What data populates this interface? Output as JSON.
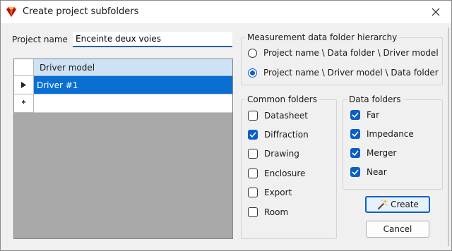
{
  "window": {
    "title": "Create project subfolders",
    "icon": "app-logo-icon",
    "close_icon": "close-icon"
  },
  "project": {
    "label": "Project name",
    "value": "Enceinte deux voies"
  },
  "grid": {
    "column_header": "Driver model",
    "rows": [
      {
        "value": "Driver #1",
        "selected": true,
        "indicator": "current-row-arrow-icon"
      },
      {
        "value": "",
        "selected": false,
        "indicator": "new-row-asterisk-icon"
      }
    ]
  },
  "hierarchy": {
    "title": "Measurement data folder hierarchy",
    "options": [
      {
        "label": "Project name \\ Data folder \\ Driver model",
        "selected": false
      },
      {
        "label": "Project name \\ Driver model \\ Data folder",
        "selected": true
      }
    ]
  },
  "common_folders": {
    "title": "Common folders",
    "items": [
      {
        "label": "Datasheet",
        "checked": false
      },
      {
        "label": "Diffraction",
        "checked": true
      },
      {
        "label": "Drawing",
        "checked": false
      },
      {
        "label": "Enclosure",
        "checked": false
      },
      {
        "label": "Export",
        "checked": false
      },
      {
        "label": "Room",
        "checked": false
      }
    ]
  },
  "data_folders": {
    "title": "Data folders",
    "items": [
      {
        "label": "Far",
        "checked": true
      },
      {
        "label": "Impedance",
        "checked": true
      },
      {
        "label": "Merger",
        "checked": true
      },
      {
        "label": "Near",
        "checked": true
      }
    ]
  },
  "buttons": {
    "create": "Create",
    "create_icon": "magic-wand-icon",
    "cancel": "Cancel"
  },
  "colors": {
    "accent": "#0a5fc6",
    "selection": "#0a6fd3",
    "grid_background": "#a9a9a9",
    "header_background": "#cde3f5"
  }
}
